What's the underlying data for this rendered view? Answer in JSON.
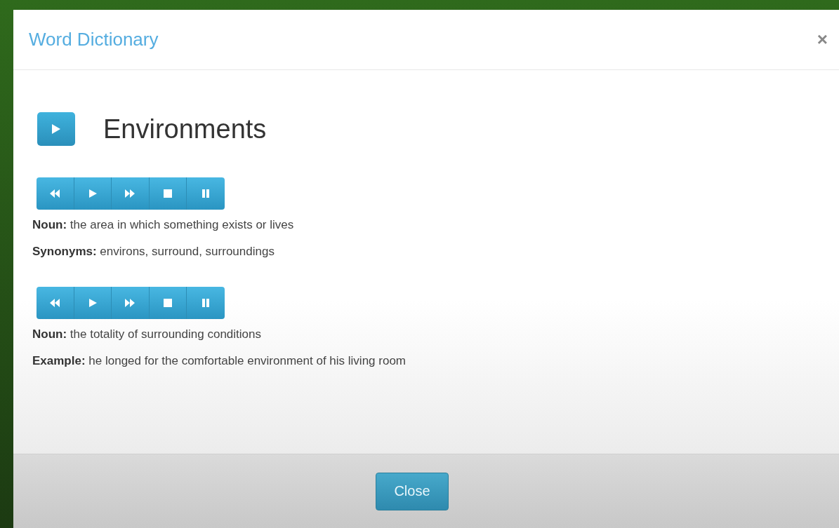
{
  "dialog": {
    "title": "Word Dictionary",
    "close_glyph": "×"
  },
  "word": {
    "text": "Environments"
  },
  "senses": [
    {
      "definition": "**Noun:** the area in which something exists or lives",
      "note": "**Synonyms:** environs, surround, surroundings"
    },
    {
      "definition": "**Noun:** the totality of surrounding conditions",
      "note": "**Example:** he longed for the comfortable environment of his living room"
    }
  ],
  "footer": {
    "button": "Close"
  }
}
